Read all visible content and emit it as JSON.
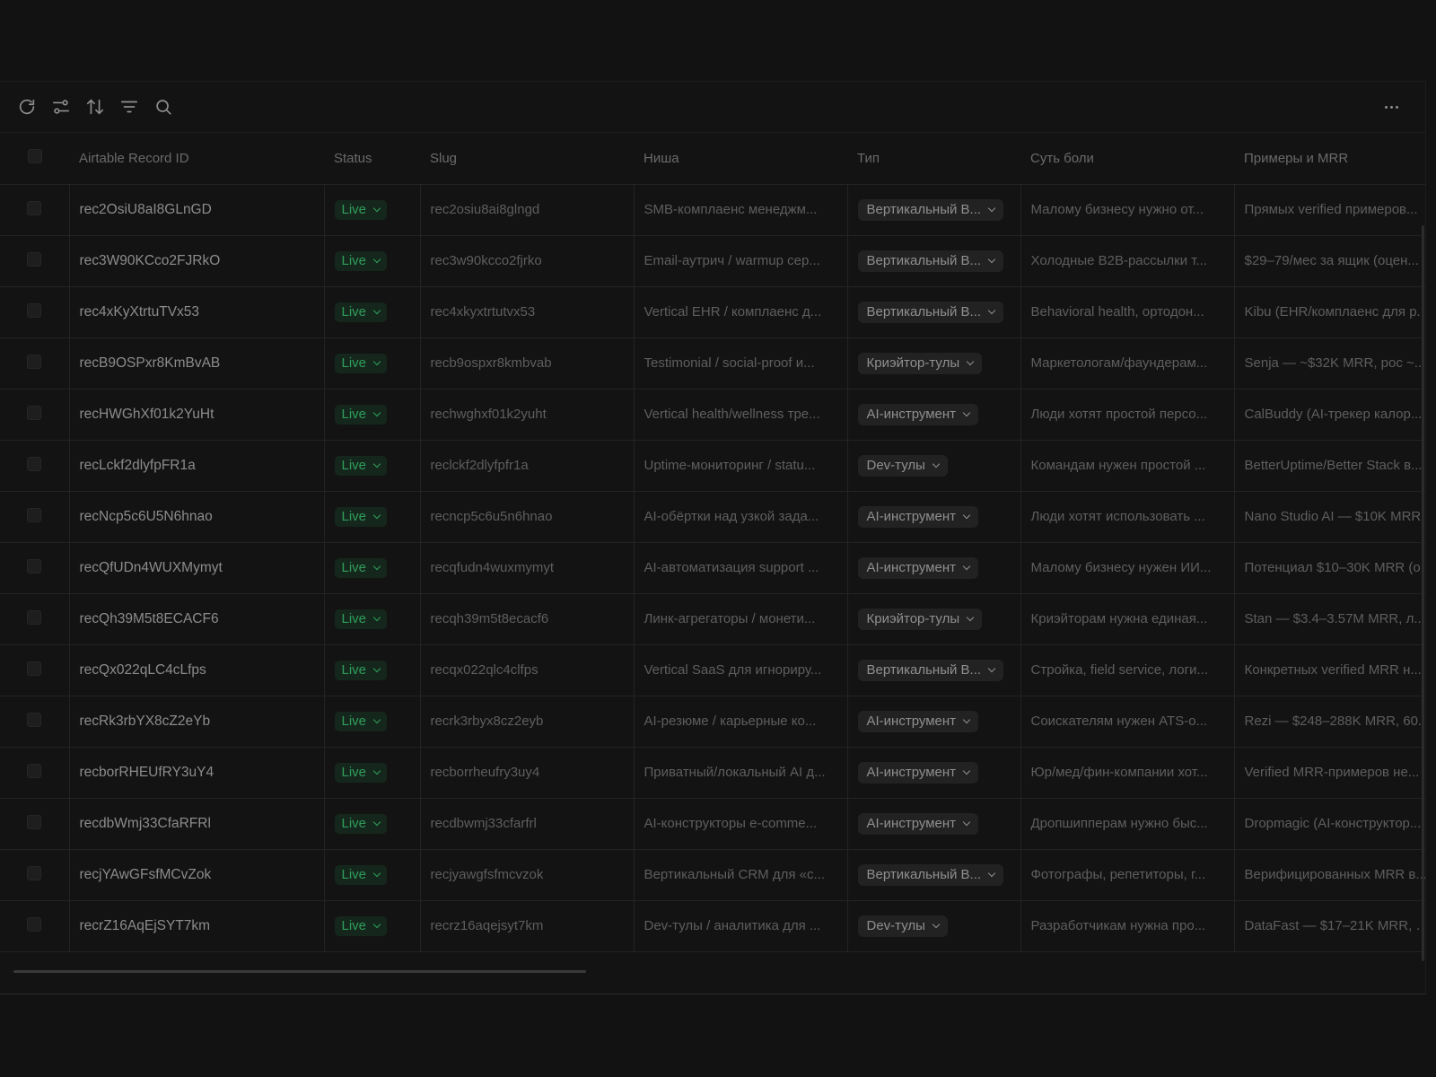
{
  "toolbar": {
    "icons": [
      "refresh-icon",
      "settings-sliders-icon",
      "sort-icon",
      "filter-icon",
      "search-icon"
    ],
    "more_icon": "more-horizontal-icon"
  },
  "table": {
    "columns": [
      "Airtable Record ID",
      "Status",
      "Slug",
      "Ниша",
      "Тип",
      "Суть боли",
      "Примеры и MRR"
    ],
    "rows": [
      {
        "id": "rec2OsiU8aI8GLnGD",
        "status": "Live",
        "slug": "rec2osiu8ai8glngd",
        "niche": "SMB-комплаенс менеджм...",
        "type": "Вертикальный В...",
        "pain": "Малому бизнесу нужно от...",
        "mrr": "Прямых verified примеров..."
      },
      {
        "id": "rec3W90KCco2FJRkO",
        "status": "Live",
        "slug": "rec3w90kcco2fjrko",
        "niche": "Email-аутрич / warmup сер...",
        "type": "Вертикальный В...",
        "pain": "Холодные B2B-рассылки т...",
        "mrr": "$29–79/мес за ящик (оцен..."
      },
      {
        "id": "rec4xKyXtrtuTVx53",
        "status": "Live",
        "slug": "rec4xkyxtrtutvx53",
        "niche": "Vertical EHR / комплаенс д...",
        "type": "Вертикальный В...",
        "pain": "Behavioral health, ортодон...",
        "mrr": "Kibu (EHR/комплаенс для р..."
      },
      {
        "id": "recB9OSPxr8KmBvAB",
        "status": "Live",
        "slug": "recb9ospxr8kmbvab",
        "niche": "Testimonial / social-proof и...",
        "type": "Криэйтор-тулы",
        "pain": "Маркетологам/фаундерам...",
        "mrr": "Senja — ~$32K MRR, рос ~..."
      },
      {
        "id": "recHWGhXf01k2YuHt",
        "status": "Live",
        "slug": "rechwghxf01k2yuht",
        "niche": "Vertical health/wellness тре...",
        "type": "AI-инструмент",
        "pain": "Люди хотят простой персо...",
        "mrr": "CalBuddy (AI-трекер калор..."
      },
      {
        "id": "recLckf2dlyfpFR1a",
        "status": "Live",
        "slug": "reclckf2dlyfpfr1a",
        "niche": "Uptime-мониторинг / statu...",
        "type": "Dev-тулы",
        "pain": "Командам нужен простой ...",
        "mrr": "BetterUptime/Better Stack в..."
      },
      {
        "id": "recNcp5c6U5N6hnao",
        "status": "Live",
        "slug": "recncp5c6u5n6hnao",
        "niche": "AI-обёртки над узкой зада...",
        "type": "AI-инструмент",
        "pain": "Люди хотят использовать ...",
        "mrr": "Nano Studio AI — $10K MRR..."
      },
      {
        "id": "recQfUDn4WUXMymyt",
        "status": "Live",
        "slug": "recqfudn4wuxmymyt",
        "niche": "AI-автоматизация support ...",
        "type": "AI-инструмент",
        "pain": "Малому бизнесу нужен ИИ...",
        "mrr": "Потенциал $10–30K MRR (о..."
      },
      {
        "id": "recQh39M5t8ECACF6",
        "status": "Live",
        "slug": "recqh39m5t8ecacf6",
        "niche": "Линк-агрегаторы / монети...",
        "type": "Криэйтор-тулы",
        "pain": "Криэйторам нужна единая...",
        "mrr": "Stan — $3.4–3.57M MRR, л..."
      },
      {
        "id": "recQx022qLC4cLfps",
        "status": "Live",
        "slug": "recqx022qlc4clfps",
        "niche": "Vertical SaaS для игнориру...",
        "type": "Вертикальный В...",
        "pain": "Стройка, field service, логи...",
        "mrr": "Конкретных verified MRR н..."
      },
      {
        "id": "recRk3rbYX8cZ2eYb",
        "status": "Live",
        "slug": "recrk3rbyx8cz2eyb",
        "niche": "AI-резюме / карьерные ко...",
        "type": "AI-инструмент",
        "pain": "Соискателям нужен ATS-о...",
        "mrr": "Rezi — $248–288K MRR, 60..."
      },
      {
        "id": "recborRHEUfRY3uY4",
        "status": "Live",
        "slug": "recborrheufry3uy4",
        "niche": "Приватный/локальный AI д...",
        "type": "AI-инструмент",
        "pain": "Юр/мед/фин-компании хот...",
        "mrr": "Verified MRR-примеров не..."
      },
      {
        "id": "recdbWmj33CfaRFRl",
        "status": "Live",
        "slug": "recdbwmj33cfarfrl",
        "niche": "AI-конструкторы e-comme...",
        "type": "AI-инструмент",
        "pain": "Дропшипперам нужно быс...",
        "mrr": "Dropmagic (AI-конструктор..."
      },
      {
        "id": "recjYAwGFsfMCvZok",
        "status": "Live",
        "slug": "recjyawgfsfmcvzok",
        "niche": "Вертикальный CRM для «с...",
        "type": "Вертикальный В...",
        "pain": "Фотографы, репетиторы, г...",
        "mrr": "Верифицированных MRR в..."
      },
      {
        "id": "recrZ16AqEjSYT7km",
        "status": "Live",
        "slug": "recrz16aqejsyt7km",
        "niche": "Dev-тулы / аналитика для ...",
        "type": "Dev-тулы",
        "pain": "Разработчикам нужна про...",
        "mrr": "DataFast — $17–21K MRR, S..."
      }
    ]
  },
  "colors": {
    "background": "#121212",
    "live_text": "#2f9d5b",
    "live_bg": "#15271c"
  }
}
